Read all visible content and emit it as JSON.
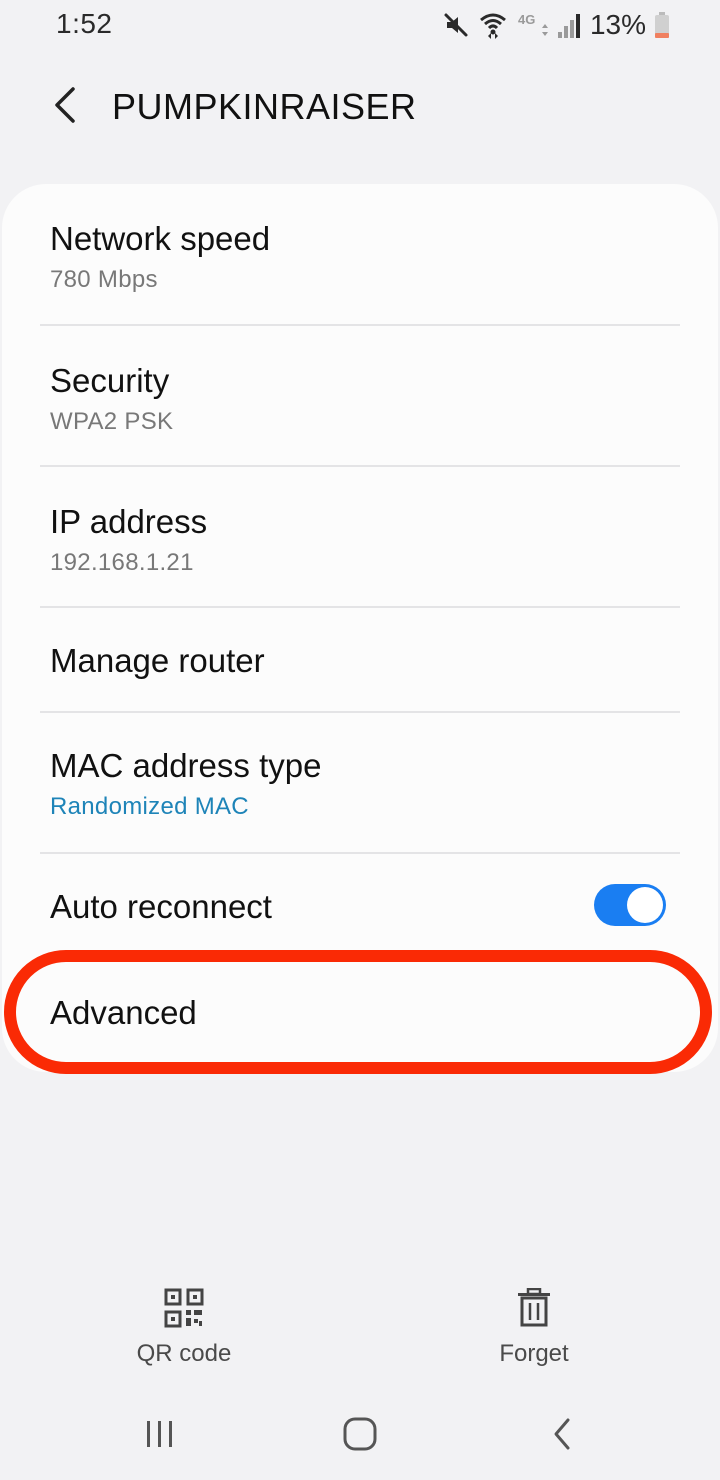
{
  "status_bar": {
    "time": "1:52",
    "network_label": "4G",
    "battery": "13%",
    "icons": [
      "mute-icon",
      "wifi-icon",
      "lte-icon",
      "signal-icon",
      "battery-icon"
    ]
  },
  "header": {
    "title": "PUMPKINRAISER",
    "back_icon": "chevron-left-icon"
  },
  "settings": [
    {
      "title": "Network speed",
      "subtitle": "780 Mbps"
    },
    {
      "title": "Security",
      "subtitle": "WPA2 PSK"
    },
    {
      "title": "IP address",
      "subtitle": "192.168.1.21"
    },
    {
      "title": "Manage router"
    },
    {
      "title": "MAC address type",
      "subtitle": "Randomized MAC"
    },
    {
      "title": "Auto reconnect",
      "toggle_on": true
    },
    {
      "title": "Advanced"
    }
  ],
  "bottom_actions": {
    "qr_label": "QR code",
    "forget_label": "Forget"
  },
  "colors": {
    "accent": "#1e84b8",
    "toggle": "#1a7ef2",
    "highlight": "#fa2a05",
    "background": "#f2f2f4",
    "card": "#fcfcfc"
  }
}
